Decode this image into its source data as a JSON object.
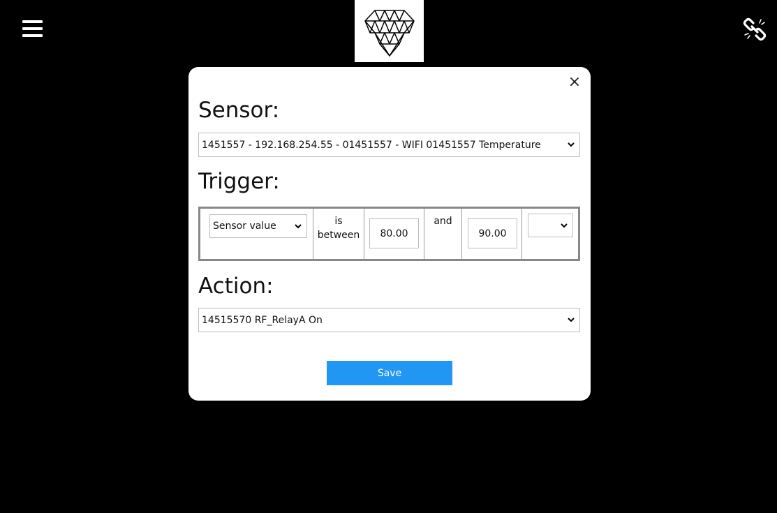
{
  "header": {
    "menu_icon": "hamburger-menu-icon",
    "logo_icon": "diamond-logo-icon",
    "status_icon": "broken-link-icon"
  },
  "modal": {
    "close_label": "×",
    "sensor": {
      "heading": "Sensor:",
      "selected": "1451557 - 192.168.254.55 - 01451557 - WIFI 01451557 Temperature"
    },
    "trigger": {
      "heading": "Trigger:",
      "source_selected": "Sensor value",
      "condition_text": "is between",
      "value_from": "80.00",
      "and_text": "and",
      "value_to": "90.00",
      "extra_selected": ""
    },
    "action": {
      "heading": "Action:",
      "selected": "14515570 RF_RelayA On"
    },
    "save_label": "Save"
  },
  "colors": {
    "background": "#000000",
    "modal_bg": "#ffffff",
    "save_button": "#2196f3"
  }
}
